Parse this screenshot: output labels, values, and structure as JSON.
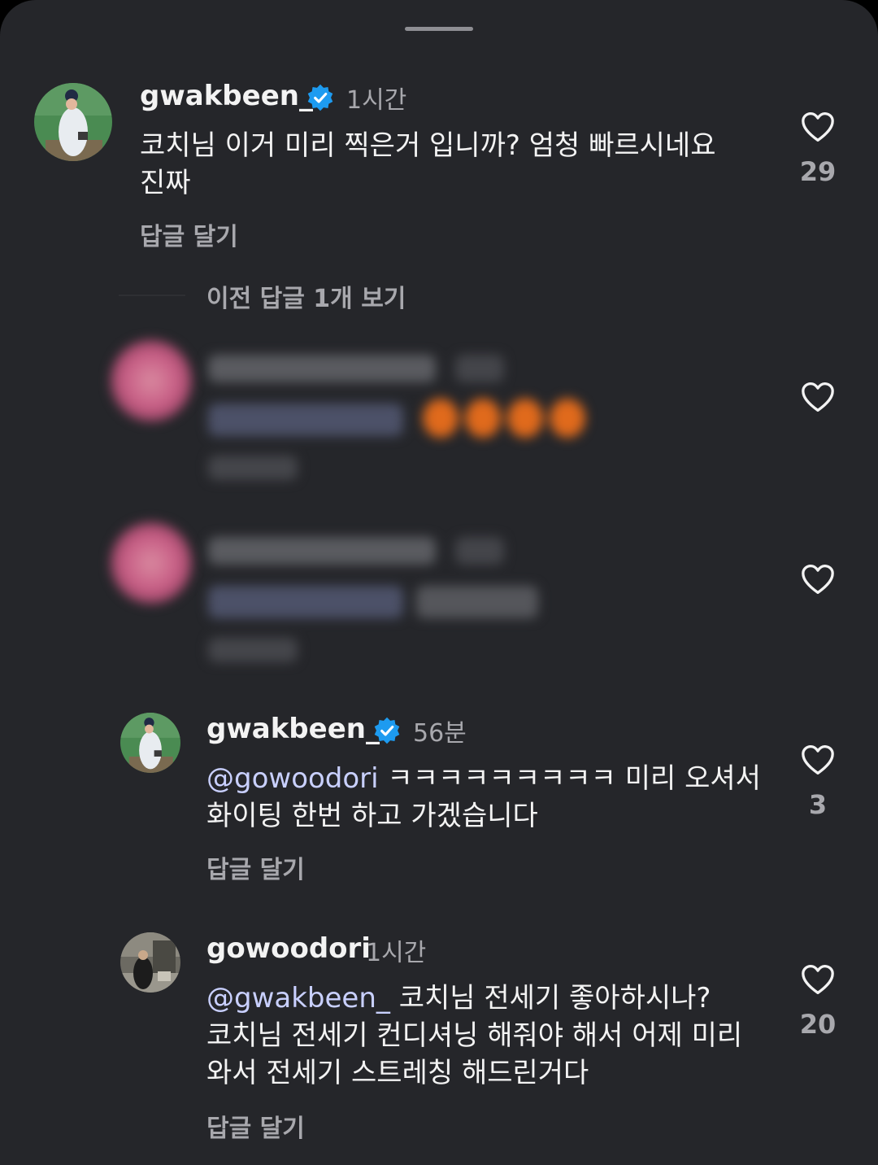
{
  "comments": [
    {
      "username": "gwakbeen_",
      "verified": true,
      "time": "1시간",
      "body_line1": "코치님 이거 미리 찍은거 입니까? 엄청 빠르시네요",
      "body_line2": "진짜",
      "reply_label": "답글 달기",
      "like_count": "29"
    },
    {
      "username": "gwakbeen_",
      "verified": true,
      "time": "56분",
      "mention": "@gowoodori",
      "body_line1_rest": " ㅋㅋㅋㅋㅋㅋㅋㅋㅋ 미리 오셔서",
      "body_line2": "화이팅 한번 하고 가겠습니다",
      "reply_label": "답글 달기",
      "like_count": "3"
    },
    {
      "username": "gowoodori",
      "verified": false,
      "time": "1시간",
      "mention": "@gwakbeen_",
      "body_line1_rest": " 코치님 전세기 좋아하시나?",
      "body_line2": "코치님 전세기 컨디셔닝 해줘야 해서 어제 미리",
      "body_line3": "와서 전세기 스트레칭 해드린거다",
      "reply_label": "답글 달기",
      "like_count": "20"
    }
  ],
  "view_previous": "이전 답글 1개 보기",
  "icons": {
    "like": "heart-outline-icon",
    "verified": "verified-badge-icon"
  },
  "colors": {
    "background": "#25262a",
    "text": "#f3f3f3",
    "muted": "#a8a8ad",
    "verified": "#1d9bf0",
    "mention": "#c9d0ff"
  }
}
